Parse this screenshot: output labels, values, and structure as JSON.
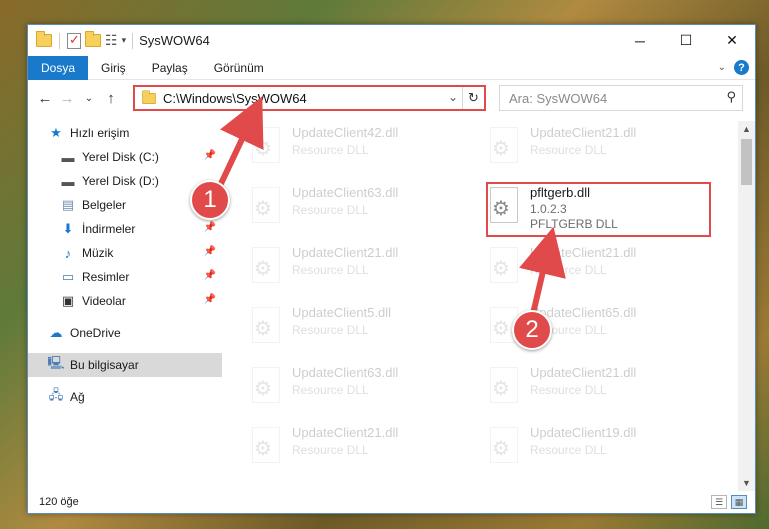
{
  "window": {
    "title": "SysWOW64",
    "controls": {
      "minimize": "─",
      "maximize": "☐",
      "close": "✕"
    }
  },
  "ribbon": {
    "tabs": [
      {
        "label": "Dosya",
        "active": true
      },
      {
        "label": "Giriş",
        "active": false
      },
      {
        "label": "Paylaş",
        "active": false
      },
      {
        "label": "Görünüm",
        "active": false
      }
    ]
  },
  "nav": {
    "address": "C:\\Windows\\SysWOW64",
    "search_placeholder": "Ara: SysWOW64"
  },
  "sidebar": {
    "items": [
      {
        "label": "Hızlı erişim",
        "icon": "star-icon",
        "pinned": false
      },
      {
        "label": "Yerel Disk (C:)",
        "icon": "drive-icon",
        "pinned": true
      },
      {
        "label": "Yerel Disk (D:)",
        "icon": "drive-icon",
        "pinned": false
      },
      {
        "label": "Belgeler",
        "icon": "documents-icon",
        "pinned": true
      },
      {
        "label": "İndirmeler",
        "icon": "download-icon",
        "pinned": true
      },
      {
        "label": "Müzik",
        "icon": "music-icon",
        "pinned": true
      },
      {
        "label": "Resimler",
        "icon": "pictures-icon",
        "pinned": true
      },
      {
        "label": "Videolar",
        "icon": "videos-icon",
        "pinned": true
      },
      {
        "label": "OneDrive",
        "icon": "cloud-icon",
        "pinned": false
      },
      {
        "label": "Bu bilgisayar",
        "icon": "computer-icon",
        "pinned": false,
        "selected": true
      },
      {
        "label": "Ağ",
        "icon": "network-icon",
        "pinned": false
      }
    ]
  },
  "files": [
    {
      "name": "UpdateClient42.dll",
      "sub": "Resource DLL"
    },
    {
      "name": "UpdateClient21.dll",
      "sub": "Resource DLL"
    },
    {
      "name": "UpdateClient63.dll",
      "sub": "Resource DLL"
    },
    {
      "name": "pfltgerb.dll",
      "sub": "1.0.2.3",
      "sub2": "PFLTGERB DLL"
    },
    {
      "name": "UpdateClient21.dll",
      "sub": "Resource DLL"
    },
    {
      "name": "UpdateClient21.dll",
      "sub": "Resource DLL"
    },
    {
      "name": "UpdateClient5.dll",
      "sub": "Resource DLL"
    },
    {
      "name": "UpdateClient65.dll",
      "sub": "Resource DLL"
    },
    {
      "name": "UpdateClient63.dll",
      "sub": "Resource DLL"
    },
    {
      "name": "UpdateClient21.dll",
      "sub": "Resource DLL"
    },
    {
      "name": "UpdateClient21.dll",
      "sub": "Resource DLL"
    },
    {
      "name": "UpdateClient19.dll",
      "sub": "Resource DLL"
    }
  ],
  "status": {
    "count": "120 öğe"
  },
  "annotations": {
    "step1": "1",
    "step2": "2",
    "color": "#e14a4a"
  }
}
